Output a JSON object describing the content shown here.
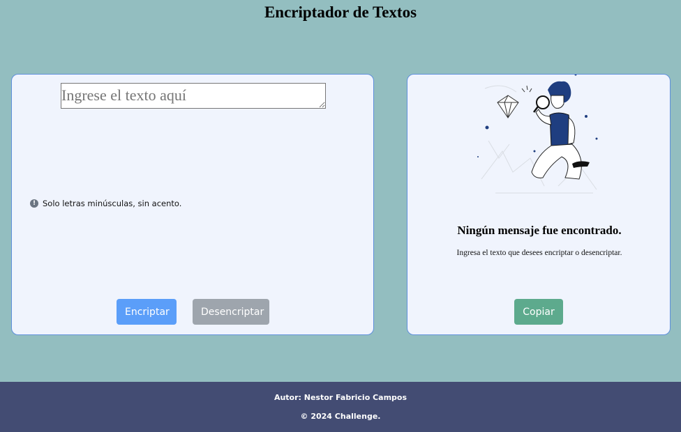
{
  "header": {
    "title": "Encriptador de Textos"
  },
  "input_panel": {
    "textarea": {
      "value": "",
      "placeholder": "Ingrese el texto aquí"
    },
    "hint_icon": "info-icon",
    "hint_text": "Solo letras minúsculas, sin acento.",
    "encrypt_label": "Encriptar",
    "decrypt_label": "Desencriptar"
  },
  "output_panel": {
    "illustration": "person-with-magnifier-illustration",
    "title": "Ningún mensaje fue encontrado.",
    "subtitle": "Ingresa el texto que desees encriptar o desencriptar.",
    "copy_label": "Copiar"
  },
  "footer": {
    "author": "Autor: Nestor Fabricio Campos",
    "copyright": "© 2024 Challenge."
  },
  "colors": {
    "background": "#93bec0",
    "panel": "#f0f4fd",
    "encrypt": "#5b9ef9",
    "decrypt": "#9ea5ad",
    "copy": "#5daa8d",
    "footer": "#434c73"
  }
}
